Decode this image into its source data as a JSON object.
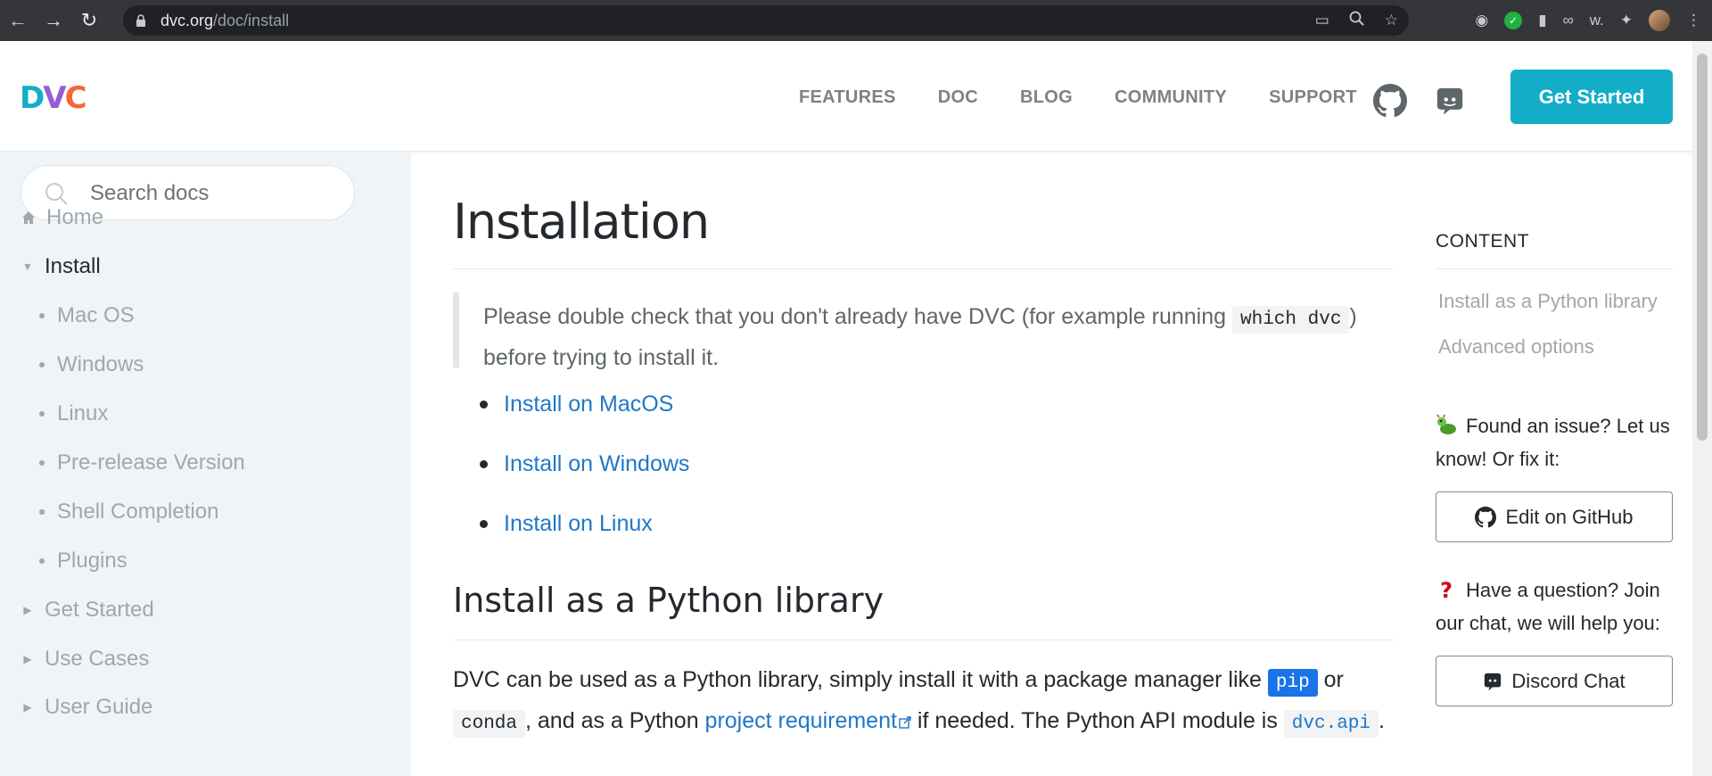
{
  "browser": {
    "url_host": "dvc.org",
    "url_path": "/doc/install"
  },
  "header": {
    "logo": {
      "d": "D",
      "v": "V",
      "c": "C"
    },
    "nav": [
      "FEATURES",
      "DOC",
      "BLOG",
      "COMMUNITY",
      "SUPPORT"
    ],
    "cta_label": "Get Started",
    "colors": {
      "brand_teal": "#13adc7",
      "brand_purple": "#945dd6",
      "brand_orange": "#f46737"
    }
  },
  "sidebar": {
    "search_placeholder": "Search docs",
    "items": [
      {
        "label": "Home"
      },
      {
        "label": "Install"
      },
      {
        "label": "Mac OS"
      },
      {
        "label": "Windows"
      },
      {
        "label": "Linux"
      },
      {
        "label": "Pre-release Version"
      },
      {
        "label": "Shell Completion"
      },
      {
        "label": "Plugins"
      },
      {
        "label": "Get Started"
      },
      {
        "label": "Use Cases"
      },
      {
        "label": "User Guide"
      }
    ]
  },
  "main": {
    "title": "Installation",
    "note": {
      "before": "Please double check that you don't already have DVC (for example running ",
      "code": "which dvc",
      "after": ")",
      "line2": "before trying to install it."
    },
    "links": [
      "Install on MacOS",
      "Install on Windows",
      "Install on Linux"
    ],
    "section_title": "Install as a Python library",
    "para": {
      "t1": "DVC can be used as a Python library, simply install it with a package manager like ",
      "code1": "pip",
      "t2": " or",
      "code2": "conda",
      "t3": ", and as a Python ",
      "link": "project requirement",
      "t4": " if needed. The Python API module is ",
      "code3": "dvc.api",
      "t5": "."
    }
  },
  "right": {
    "content_heading": "CONTENT",
    "toc": [
      "Install as a Python library",
      "Advanced options"
    ],
    "issue_text": "Found an issue? Let us know! Or fix it:",
    "edit_button": "Edit on GitHub",
    "question_text": "Have a question? Join our chat, we will help you:",
    "discord_button": "Discord Chat"
  }
}
